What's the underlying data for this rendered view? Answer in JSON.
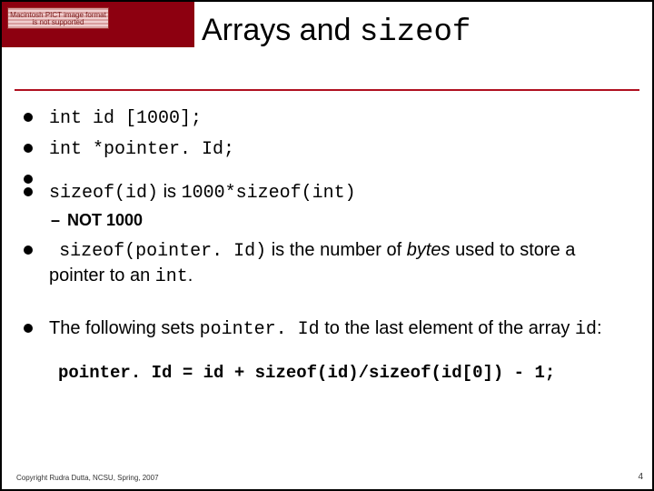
{
  "pict_badge": "Macintosh PICT image format is not supported",
  "title": {
    "plain": "Arrays and ",
    "mono": "sizeof"
  },
  "bullets": {
    "b1": "int id [1000];",
    "b2": "int *pointer. Id;",
    "b3": {
      "pre": "sizeof(id)",
      "mid": " is ",
      "post": "1000*sizeof(int)"
    },
    "b3_sub": "NOT 1000",
    "b4": {
      "lead_code": "sizeof(pointer. Id)",
      "t1": " is the number of ",
      "em": "bytes",
      "t2": " used to store a pointer to an ",
      "tail_code": "int",
      "period": "."
    },
    "b5": {
      "t1": "The following sets ",
      "c1": "pointer. Id",
      "t2": " to the last element of the array ",
      "c2": "id",
      "t3": ":"
    }
  },
  "code_line": "pointer. Id = id + sizeof(id)/sizeof(id[0]) - 1;",
  "footer": "Copyright Rudra Dutta, NCSU, Spring, 2007",
  "page_number": "4"
}
